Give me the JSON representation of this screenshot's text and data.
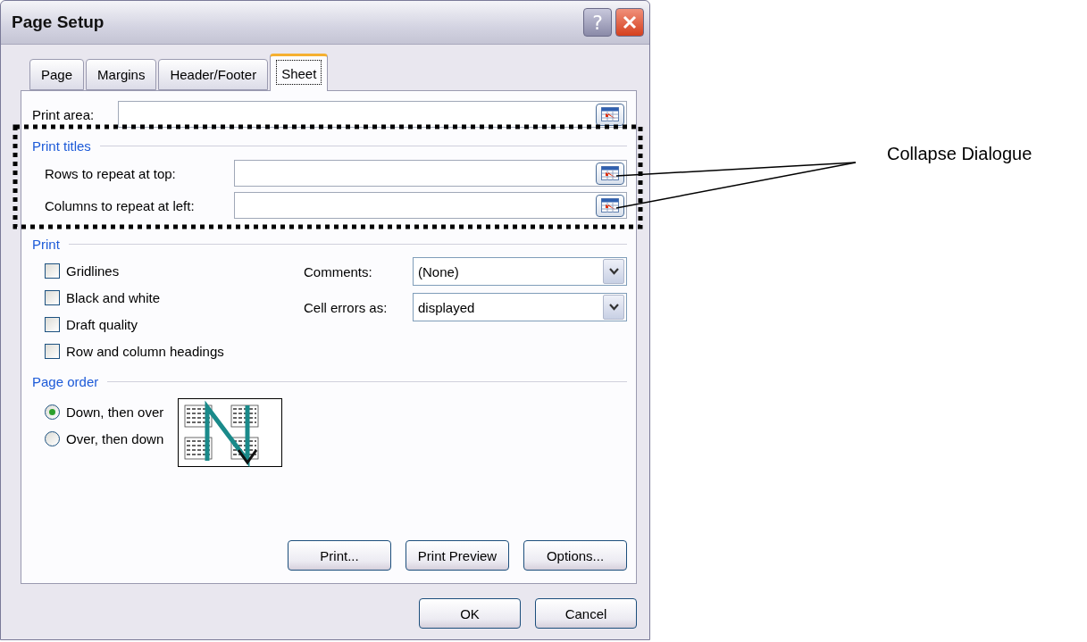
{
  "window": {
    "title": "Page Setup",
    "help_button": "?"
  },
  "tabs": [
    {
      "label": "Page",
      "selected": false
    },
    {
      "label": "Margins",
      "selected": false
    },
    {
      "label": "Header/Footer",
      "selected": false
    },
    {
      "label": "Sheet",
      "selected": true
    }
  ],
  "print_area": {
    "label": "Print area:"
  },
  "print_titles": {
    "heading": "Print titles",
    "fields": [
      {
        "label": "Rows to repeat at top:"
      },
      {
        "label": "Columns to repeat at left:"
      }
    ]
  },
  "print": {
    "heading": "Print",
    "options": [
      {
        "label": "Gridlines",
        "checked": false
      },
      {
        "label": "Black and white",
        "checked": false
      },
      {
        "label": "Draft quality",
        "checked": false
      },
      {
        "label": "Row and column headings",
        "checked": false
      }
    ],
    "dropdowns": [
      {
        "label": "Comments:",
        "value": "(None)"
      },
      {
        "label": "Cell errors as:",
        "value": "displayed"
      }
    ]
  },
  "page_order": {
    "heading": "Page order",
    "options": [
      {
        "label": "Down, then over",
        "selected": true
      },
      {
        "label": "Over, then down",
        "selected": false
      }
    ]
  },
  "panel_buttons": [
    "Print...",
    "Print Preview",
    "Options..."
  ],
  "dialog_buttons": [
    "OK",
    "Cancel"
  ],
  "annotation": {
    "text": "Collapse Dialogue"
  }
}
